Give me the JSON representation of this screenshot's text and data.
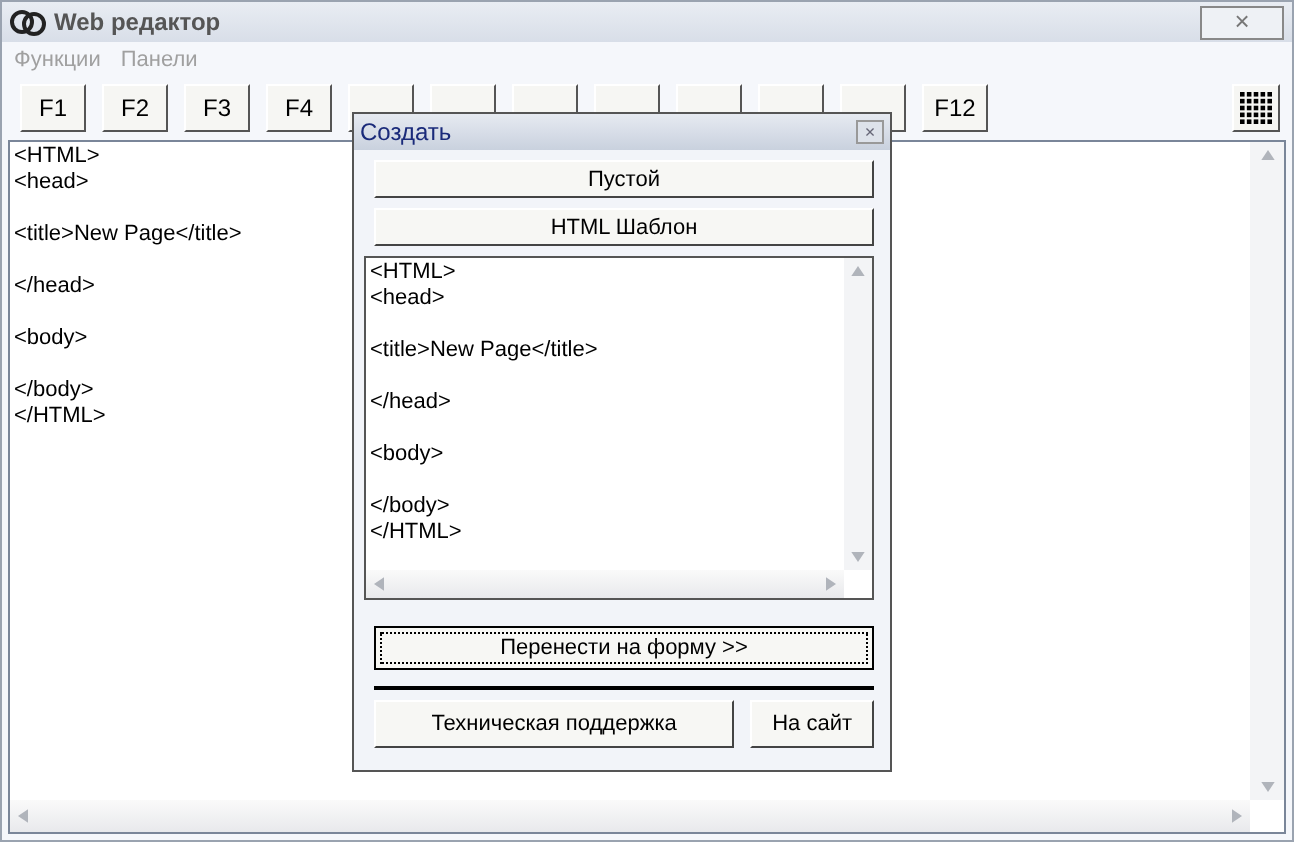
{
  "window": {
    "title": "Web редактор",
    "close": "×"
  },
  "menu": [
    {
      "label": "Функции",
      "disabled": true
    },
    {
      "label": "Панели",
      "disabled": true
    }
  ],
  "toolbar_buttons": [
    {
      "kind": "label",
      "label": "F1"
    },
    {
      "kind": "label",
      "label": "F2"
    },
    {
      "kind": "label",
      "label": "F3"
    },
    {
      "kind": "label",
      "label": "F4"
    },
    {
      "kind": "covered"
    },
    {
      "kind": "covered"
    },
    {
      "kind": "covered"
    },
    {
      "kind": "covered"
    },
    {
      "kind": "covered"
    },
    {
      "kind": "covered"
    },
    {
      "kind": "covered"
    },
    {
      "kind": "label",
      "label": "F12"
    }
  ],
  "editor": {
    "text": "<HTML>\n<head>\n\n<title>New Page</title>\n\n</head>\n\n<body>\n\n</body>\n</HTML>"
  },
  "dialog": {
    "title": "Создать",
    "close": "×",
    "template_buttons": [
      "Пустой",
      "HTML Шаблон"
    ],
    "preview": {
      "text": "<HTML>\n<head>\n\n<title>New Page</title>\n\n</head>\n\n<body>\n\n</body>\n</HTML>"
    },
    "transfer_button": "Перенести на форму >>",
    "bottom_buttons": [
      "Техническая поддержка",
      "На сайт"
    ]
  }
}
